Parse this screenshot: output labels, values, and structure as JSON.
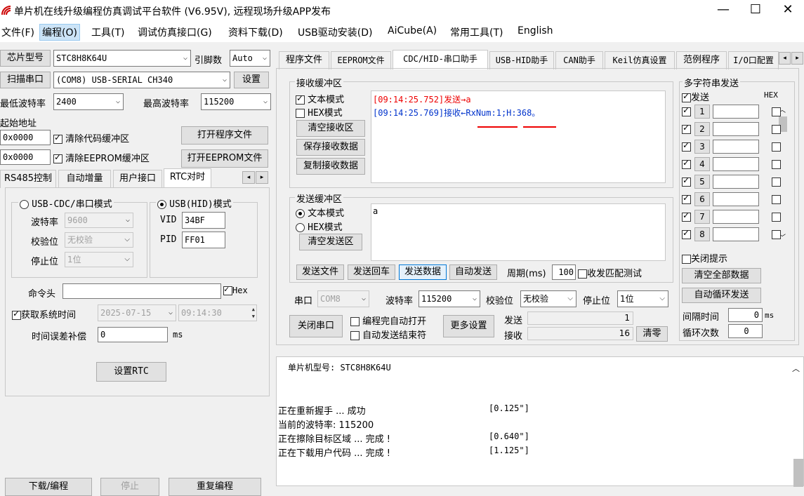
{
  "window": {
    "title": "单片机在线升级编程仿真调试平台软件 (V6.95V), 远程现场升级APP发布",
    "minimize": "—",
    "maximize": "☐",
    "close": "✕"
  },
  "menu": [
    "文件(F)",
    "编程(O)",
    "工具(T)",
    "调试仿真接口(G)",
    "资料下载(D)",
    "USB驱动安装(D)",
    "AiCube(A)",
    "常用工具(T)",
    "English"
  ],
  "left": {
    "chip_label": "芯片型号",
    "chip_value": "STC8H8K64U",
    "pins_label": "引脚数",
    "pins_value": "Auto",
    "scan_port": "扫描串口",
    "port_value": "(COM8) USB-SERIAL CH340",
    "settings": "设置",
    "min_baud_label": "最低波特率",
    "min_baud": "2400",
    "max_baud_label": "最高波特率",
    "max_baud": "115200",
    "start_addr_label": "起始地址",
    "addr1": "0x0000",
    "clear_code": "清除代码缓冲区",
    "open_program": "打开程序文件",
    "addr2": "0x0000",
    "clear_eeprom": "清除EEPROM缓冲区",
    "open_eeprom": "打开EEPROM文件",
    "tabs": [
      "RS485控制",
      "自动增量",
      "用户接口",
      "RTC对时"
    ],
    "rtc": {
      "usb_cdc": "USB-CDC/串口模式",
      "usb_hid": "USB(HID)模式",
      "baud_label": "波特率",
      "baud": "9600",
      "parity_label": "校验位",
      "parity": "无校验",
      "stop_label": "停止位",
      "stop": "1位",
      "vid_label": "VID",
      "vid": "34BF",
      "pid_label": "PID",
      "pid": "FF01",
      "cmd_label": "命令头",
      "cmd_value": "",
      "hex": "Hex",
      "get_time": "获取系统时间",
      "date": "2025-07-15",
      "time": "09:14:30",
      "err_label": "时间误差补偿",
      "err_value": "0",
      "ms": "ms",
      "set_rtc": "设置RTC"
    },
    "bottom_buttons": [
      "下载/编程",
      "停止",
      "重复编程"
    ]
  },
  "right": {
    "tabs": [
      "程序文件",
      "EEPROM文件",
      "CDC/HID-串口助手",
      "USB-HID助手",
      "CAN助手",
      "Keil仿真设置",
      "范例程序",
      "I/O口配置"
    ],
    "recv": {
      "title": "接收缓冲区",
      "text_mode": "文本模式",
      "hex_mode": "HEX模式",
      "clear": "清空接收区",
      "save": "保存接收数据",
      "copy": "复制接收数据",
      "line1": "[09:14:25.752]发送→a",
      "line2": "[09:14:25.769]接收←RxNum:1;H:368。"
    },
    "send": {
      "title": "发送缓冲区",
      "text_mode": "文本模式",
      "hex_mode": "HEX模式",
      "clear": "清空发送区",
      "content": "a",
      "send_file": "发送文件",
      "send_enter": "发送回车",
      "send_data": "发送数据",
      "auto_send": "自动发送",
      "period_label": "周期(ms)",
      "period": "100",
      "match_test": "收发匹配测试"
    },
    "serial": {
      "port_label": "串口",
      "port": "COM8",
      "baud_label": "波特率",
      "baud": "115200",
      "parity_label": "校验位",
      "parity": "无校验",
      "stop_label": "停止位",
      "stop": "1位",
      "close": "关闭串口",
      "open_after": "编程完自动打开",
      "auto_end": "自动发送结束符",
      "more": "更多设置",
      "sent_label": "发送",
      "sent": "1",
      "recv_label": "接收",
      "recv": "16",
      "clear_count": "清零"
    },
    "multi": {
      "title": "多字符串发送",
      "send_col": "发送",
      "hex_col": "HEX",
      "rows": [
        "1",
        "2",
        "3",
        "4",
        "5",
        "6",
        "7",
        "8"
      ],
      "close_tip": "关闭提示",
      "clear_all": "清空全部数据",
      "auto_loop": "自动循环发送",
      "interval_label": "间隔时间",
      "interval": "0",
      "ms": "ms",
      "loop_label": "循环次数",
      "loop": "0"
    },
    "log": {
      "model_line": "单片机型号: STC8H8K64U",
      "lines": [
        {
          "text": "正在重新握手 ... 成功",
          "time": "[0.125\"]"
        },
        {
          "text": "当前的波特率: 115200",
          "time": ""
        },
        {
          "text": "正在擦除目标区域 ... 完成 !",
          "time": "[0.640\"]"
        },
        {
          "text": "正在下载用户代码 ... 完成 !",
          "time": "[1.125\"]"
        }
      ]
    }
  }
}
